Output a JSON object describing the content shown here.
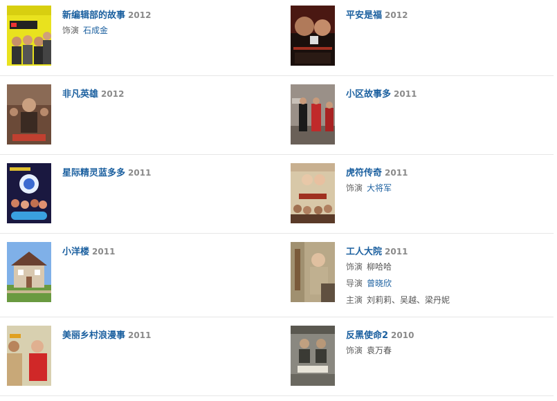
{
  "items": [
    {
      "title": "新编辑部的故事",
      "year": "2012",
      "poster": "yellow-cast-poster",
      "meta": [
        {
          "label": "饰演",
          "value": "石成金",
          "link": true
        }
      ]
    },
    {
      "title": "平安是福",
      "year": "2012",
      "poster": "dark-red-drama-poster",
      "meta": []
    },
    {
      "title": "非凡英雄",
      "year": "2012",
      "poster": "brown-hero-poster",
      "meta": []
    },
    {
      "title": "小区故事多",
      "year": "2011",
      "poster": "street-scene-poster",
      "meta": []
    },
    {
      "title": "星际精灵蓝多多",
      "year": "2011",
      "poster": "space-fantasy-poster",
      "meta": []
    },
    {
      "title": "虎符传奇",
      "year": "2011",
      "poster": "costume-drama-poster",
      "meta": [
        {
          "label": "饰演",
          "value": "大将军",
          "link": true
        }
      ]
    },
    {
      "title": "小洋楼",
      "year": "2011",
      "poster": "house-photo-poster",
      "meta": []
    },
    {
      "title": "工人大院",
      "year": "2011",
      "poster": "workers-yard-poster",
      "meta": [
        {
          "label": "饰演",
          "value": "柳哈哈",
          "link": false
        },
        {
          "label": "导演",
          "value": "曾晓欣",
          "link": true
        },
        {
          "label": "主演",
          "value": "刘莉莉、吴越、梁丹妮",
          "link": false
        }
      ]
    },
    {
      "title": "美丽乡村浪漫事",
      "year": "2011",
      "poster": "village-couple-poster",
      "meta": []
    },
    {
      "title": "反黑使命2",
      "year": "2010",
      "poster": "gray-police-poster",
      "meta": [
        {
          "label": "饰演",
          "value": "袁万春",
          "link": false
        }
      ]
    }
  ]
}
